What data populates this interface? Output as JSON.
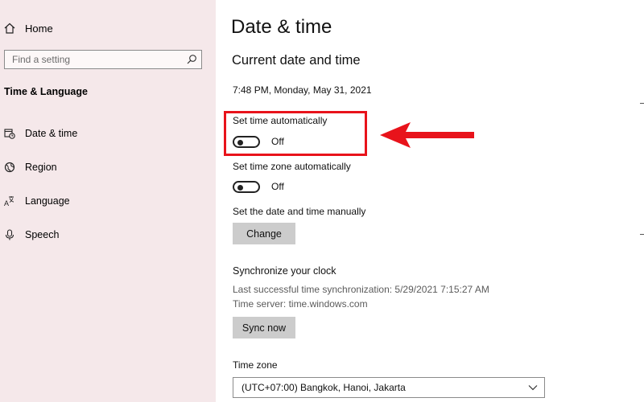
{
  "sidebar": {
    "home_label": "Home",
    "search_placeholder": "Find a setting",
    "section_title": "Time & Language",
    "items": [
      {
        "label": "Date & time",
        "icon": "calendar-clock-icon"
      },
      {
        "label": "Region",
        "icon": "globe-icon"
      },
      {
        "label": "Language",
        "icon": "language-icon"
      },
      {
        "label": "Speech",
        "icon": "microphone-icon"
      }
    ]
  },
  "main": {
    "page_title": "Date & time",
    "subtitle": "Current date and time",
    "current_datetime": "7:48 PM, Monday, May 31, 2021",
    "set_time_auto": {
      "label": "Set time automatically",
      "state": "Off"
    },
    "set_timezone_auto": {
      "label": "Set time zone automatically",
      "state": "Off"
    },
    "manual": {
      "label": "Set the date and time manually",
      "button": "Change"
    },
    "sync": {
      "title": "Synchronize your clock",
      "last_sync": "Last successful time synchronization: 5/29/2021 7:15:27 AM",
      "server": "Time server: time.windows.com",
      "button": "Sync now"
    },
    "timezone": {
      "label": "Time zone",
      "value": "(UTC+07:00) Bangkok, Hanoi, Jakarta"
    }
  },
  "annotation": {
    "color": "#e8131b"
  }
}
